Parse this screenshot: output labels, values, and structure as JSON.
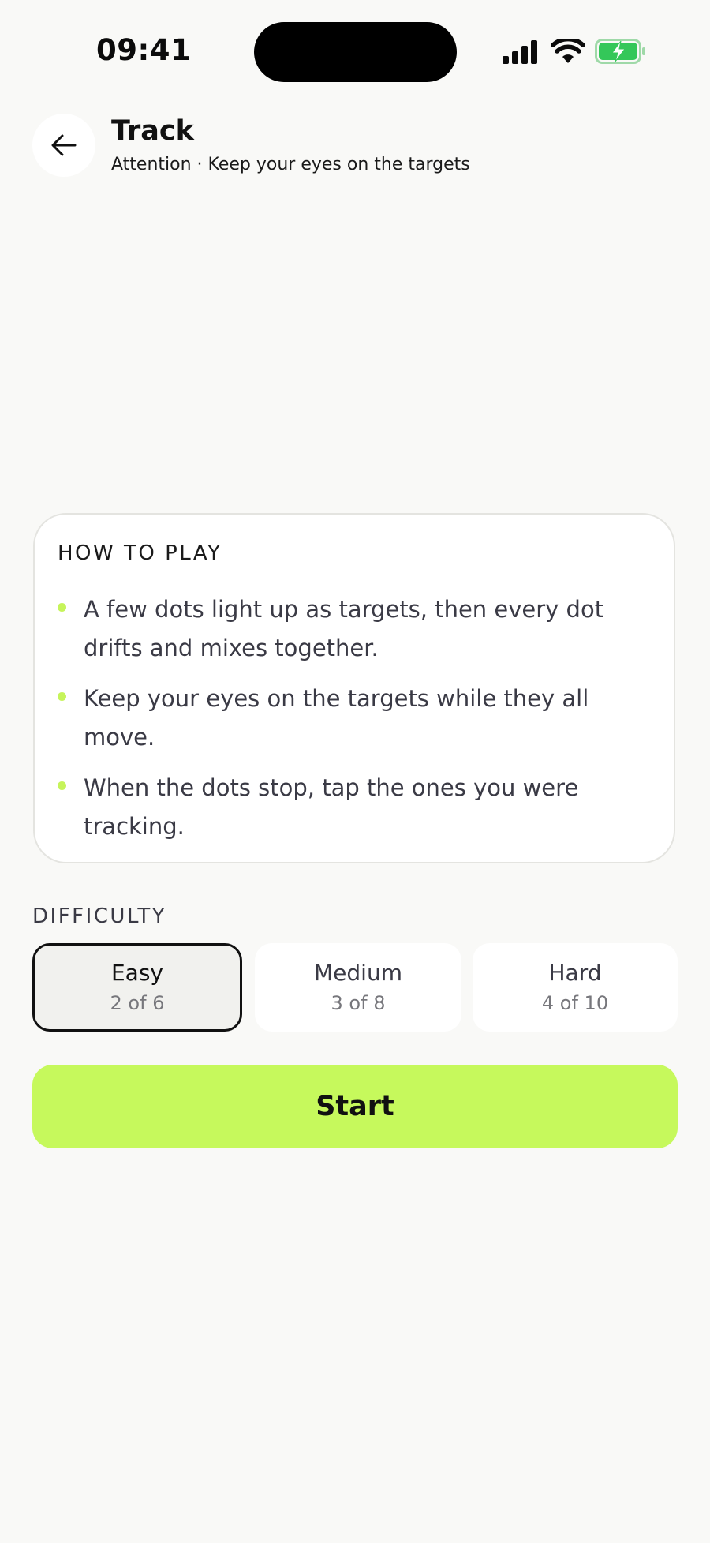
{
  "status_bar": {
    "time": "09:41",
    "icons": [
      "signal-icon",
      "wifi-icon",
      "battery-charging-icon"
    ]
  },
  "header": {
    "back_icon": "arrow-left-icon",
    "title": "Track",
    "subtitle": "Attention · Keep your eyes on the targets"
  },
  "how_to_play": {
    "title": "HOW TO PLAY",
    "items": [
      "A few dots light up as targets, then every dot drifts and mixes together.",
      "Keep your eyes on the targets while they all move.",
      "When the dots stop, tap the ones you were tracking."
    ]
  },
  "difficulty": {
    "label": "DIFFICULTY",
    "selected": "Easy",
    "options": [
      {
        "name": "Easy",
        "detail": "2 of 6"
      },
      {
        "name": "Medium",
        "detail": "3 of 8"
      },
      {
        "name": "Hard",
        "detail": "4 of 10"
      }
    ]
  },
  "start_label": "Start",
  "colors": {
    "background": "#f9f9f7",
    "accent": "#c6f95c",
    "bullet": "#c6f45a",
    "battery": "#34c759"
  }
}
